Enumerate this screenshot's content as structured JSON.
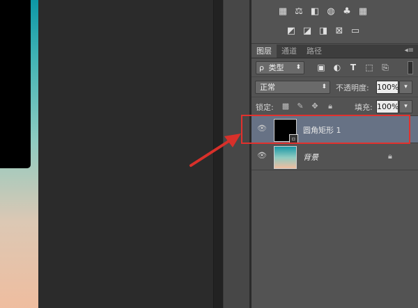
{
  "panel": {
    "tabs": [
      {
        "label": "图层",
        "active": true
      },
      {
        "label": "通道",
        "active": false
      },
      {
        "label": "路径",
        "active": false
      }
    ],
    "filter": {
      "search_glyph": "ρ",
      "label": "类型",
      "icons": [
        "image-filter-icon",
        "adjustment-filter-icon",
        "type-filter-icon",
        "shape-filter-icon",
        "smart-object-filter-icon"
      ]
    },
    "blend_mode": "正常",
    "opacity_label": "不透明度:",
    "opacity_value": "100%",
    "lock_label": "锁定:",
    "fill_label": "填充:",
    "fill_value": "100%"
  },
  "layers": [
    {
      "name": "圆角矩形 1",
      "selected": true,
      "locked": false
    },
    {
      "name": "背景",
      "selected": false,
      "locked": true
    }
  ],
  "colors": {
    "selection": "#677285",
    "highlight_box": "#e2312d",
    "panel_bg": "#535353"
  }
}
